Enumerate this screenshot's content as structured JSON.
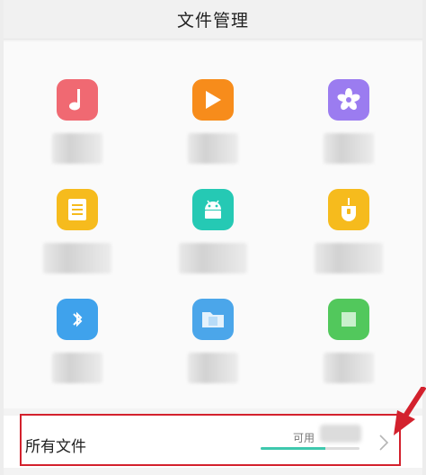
{
  "header": {
    "title": "文件管理"
  },
  "categories": [
    {
      "icon": "music-note-icon",
      "color": "#f06972"
    },
    {
      "icon": "play-video-icon",
      "color": "#f78c1b"
    },
    {
      "icon": "flower-photo-icon",
      "color": "#9b7cf0"
    },
    {
      "icon": "document-icon",
      "color": "#f6bb1d"
    },
    {
      "icon": "android-apk-icon",
      "color": "#25c9b4"
    },
    {
      "icon": "usb-drive-icon",
      "color": "#f6bb1d"
    },
    {
      "icon": "bluetooth-transfer-icon",
      "color": "#3fa2ec"
    },
    {
      "icon": "folder-icon",
      "color": "#4ba6ea"
    },
    {
      "icon": "green-app-icon",
      "color": "#52c85c"
    }
  ],
  "footer": {
    "label": "所有文件",
    "available_label": "可用",
    "storage_used_fraction": 0.65,
    "accent_color": "#3ec8ad",
    "highlight_color": "#d3212d"
  }
}
